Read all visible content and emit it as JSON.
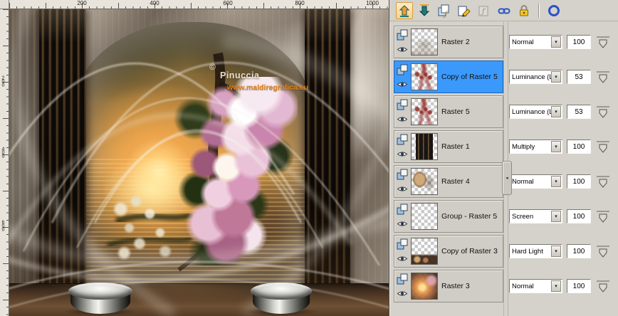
{
  "rulers": {
    "top_marks": [
      "200",
      "400",
      "600",
      "800",
      "1000"
    ],
    "left_marks": [
      "200",
      "400",
      "600"
    ]
  },
  "canvas": {
    "watermark_symbol": "©",
    "watermark_name": "Pinuccia",
    "watermark_url": "www.maldiregrafica.eu"
  },
  "layers_toolbar": {
    "buttons": [
      "move-layer-up",
      "move-layer-down",
      "new-layer",
      "new-mask-layer",
      "new-adjustment-layer",
      "link-layers",
      "lock-transparency",
      "highlight-ring"
    ]
  },
  "ui": {
    "dropdown_arrow": "▾"
  },
  "layers_panel": {
    "layers": [
      {
        "name": "Raster 2",
        "blend_mode": "Normal",
        "opacity": "100",
        "selected": false,
        "thumb": "faint"
      },
      {
        "name": "Copy of Raster 5",
        "blend_mode": "Luminance (L)",
        "opacity": "53",
        "selected": true,
        "thumb": "scribble"
      },
      {
        "name": "Raster 5",
        "blend_mode": "Luminance (L)",
        "opacity": "53",
        "selected": false,
        "thumb": "scribble"
      },
      {
        "name": "Raster 1",
        "blend_mode": "Multiply",
        "opacity": "100",
        "selected": false,
        "thumb": "stripes"
      },
      {
        "name": "Raster 4",
        "blend_mode": "Normal",
        "opacity": "100",
        "selected": false,
        "thumb": "portrait"
      },
      {
        "name": "Group - Raster 5",
        "blend_mode": "Screen",
        "opacity": "100",
        "selected": false,
        "thumb": "blank"
      },
      {
        "name": "Copy of Raster 3",
        "blend_mode": "Hard Light",
        "opacity": "100",
        "selected": false,
        "thumb": "band"
      },
      {
        "name": "Raster 3",
        "blend_mode": "Normal",
        "opacity": "100",
        "selected": false,
        "thumb": "landscape"
      }
    ]
  }
}
